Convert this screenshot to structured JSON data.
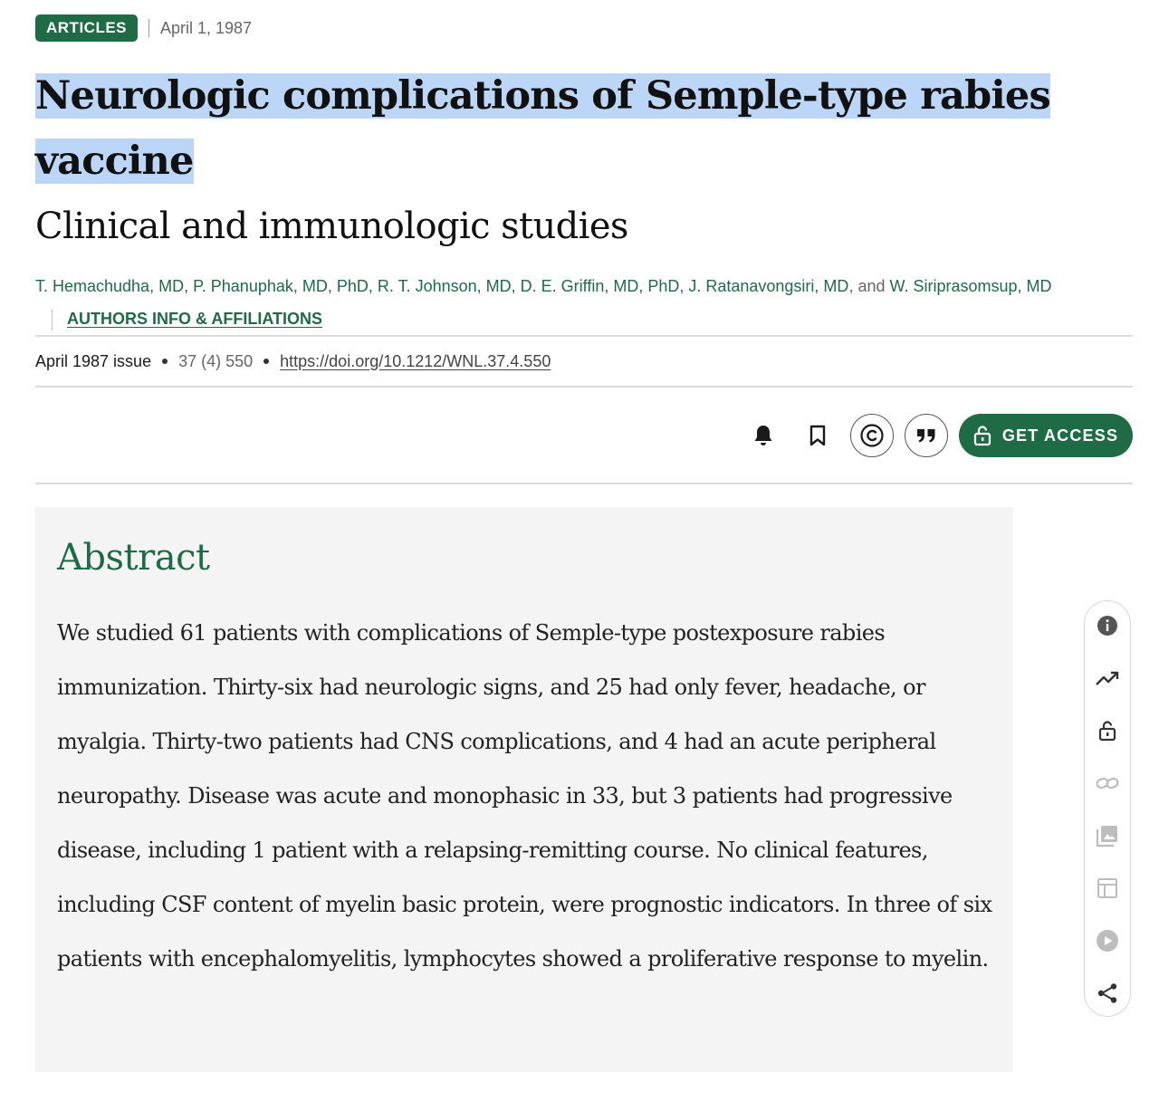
{
  "meta": {
    "badge": "ARTICLES",
    "date": "April 1, 1987"
  },
  "article": {
    "title_line1": "Neurologic complications of Semple-type rabies",
    "title_line2": "vaccine",
    "subtitle": "Clinical and immunologic studies"
  },
  "authors": {
    "list": [
      "T. Hemachudha, MD",
      "P. Phanuphak, MD, PhD",
      "R. T. Johnson, MD",
      "D. E. Griffin, MD, PhD",
      "J. Ratanavongsiri, MD",
      "W. Siriprasomsup, MD"
    ],
    "conjunction": "and",
    "affiliations_link": "AUTHORS INFO & AFFILIATIONS"
  },
  "issue": {
    "issue_label": "April 1987 issue",
    "volume": "37 (4) 550",
    "doi": "https://doi.org/10.1212/WNL.37.4.550"
  },
  "actions": {
    "icons": [
      "bell-icon",
      "bookmark-icon",
      "copyright-icon",
      "quote-icon"
    ],
    "access_label": "GET ACCESS"
  },
  "abstract": {
    "heading": "Abstract",
    "text": "We studied 61 patients with complications of Semple-type postexposure rabies immunization. Thirty-six had neurologic signs, and 25 had only fever, headache, or myalgia. Thirty-two patients had CNS complications, and 4 had an acute peripheral neuropathy. Disease was acute and monophasic in 33, but 3 patients had progressive disease, including 1 patient with a relapsing-remitting course. No clinical features, including CSF content of myelin basic protein, were prognostic indicators. In three of six patients with encephalomyelitis, lymphocytes showed a proliferative response to myelin."
  },
  "rail": {
    "items": [
      "info-icon",
      "trending-icon",
      "lock-icon",
      "link-icon",
      "images-icon",
      "table-icon",
      "play-icon",
      "share-icon"
    ]
  },
  "colors": {
    "brand_green": "#1f6b46",
    "selection_highlight": "#bcd6f7",
    "abstract_bg": "#f4f4f4"
  }
}
